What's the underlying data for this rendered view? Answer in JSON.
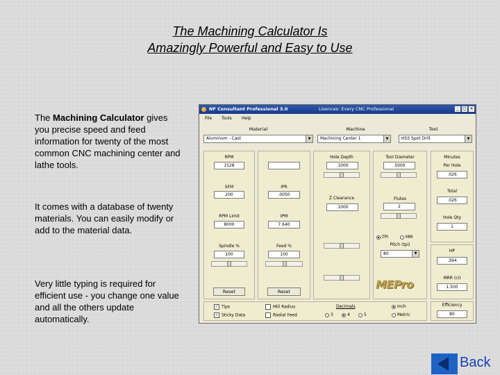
{
  "slide": {
    "title_line1": "The Machining Calculator Is",
    "title_line2": "Amazingly Powerful and Easy to Use",
    "para1_pre": "The ",
    "para1_bold": "Machining Calculator",
    "para1_post": " gives you precise speed and feed information for twenty of the most common CNC machining center and lathe tools.",
    "para2": "It comes with a database of twenty materials.  You can easily modify or add to the material data.",
    "para3": "Very little typing is required for efficient use - you change one value and all the others update automatically.",
    "back_label": "Back"
  },
  "app": {
    "title": "NF Consultant Professional 3.0",
    "subtitle": "Lisencex: Every CNC Professional",
    "menu": [
      "File",
      "Tools",
      "Help"
    ],
    "headers": {
      "material": "Material",
      "machine": "Machine",
      "tool": "Tool"
    },
    "material_value": "Aluminum - Cast",
    "machine_value": "Machining Center 1",
    "tool_value": "HSS Spot Drill",
    "fields": {
      "rpm_label": "RPM",
      "rpm": "1528",
      "sfm_label": "SFM",
      "sfm": "200",
      "ipr_label": "IPR",
      "ipr": ".0050",
      "rpm_limit_label": "RPM Limit",
      "rpm_limit": "8000",
      "ipm_label": "IPM",
      "ipm": "7.640",
      "spindle_label": "Spindle %",
      "spindle": "100",
      "feed_label": "Feed %",
      "feed": "100",
      "hole_depth_label": "Hole Depth",
      "hole_depth": ".1000",
      "z_clearance_label": "Z Clearance",
      "z_clearance": ".1000",
      "tool_diameter_label": "Tool Diameter",
      "tool_diameter": ".5000",
      "flutes_label": "Flutes",
      "flutes": "2",
      "pitch_label": "Pitch (tpi)",
      "pitch": "80",
      "minutes_label": "Minutes",
      "per_hole_label": "Per Hole",
      "per_hole": ".026",
      "total_label": "Total",
      "total": ".026",
      "hole_qty_label": "Hole Qty",
      "hole_qty": "1",
      "hp_label": "HP",
      "hp": ".394",
      "mrr_label": "MRR (ci)",
      "mrr": "1.500",
      "efficiency_label": "Efficiency",
      "efficiency": "80"
    },
    "tpi_label": "TPI",
    "mm_label": "MM",
    "reset1": "Reset",
    "reset2": "Reset",
    "tips_label": "Tips",
    "sticky_data_label": "Sticky Data",
    "mill_radius_label": "Mill Radius",
    "radial_feed_label": "Radial Feed",
    "decimals_label": "Decimals",
    "decimal_options": [
      "3",
      "4",
      "5"
    ],
    "inch_label": "Inch",
    "metric_label": "Metric",
    "logo": "MEPro"
  }
}
